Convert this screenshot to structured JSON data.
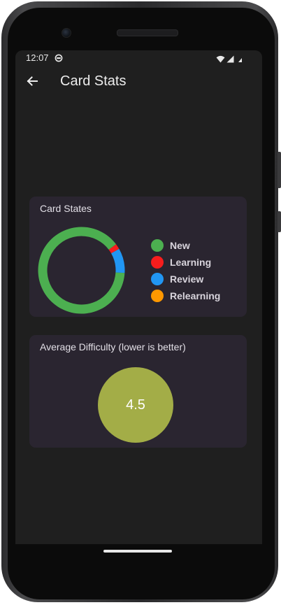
{
  "status_bar": {
    "time": "12:07",
    "icons": [
      "privacy-dot-icon",
      "wifi-icon",
      "cellular-icon",
      "battery-icon"
    ]
  },
  "app_bar": {
    "back_icon": "arrow-left-icon",
    "title": "Card Stats"
  },
  "card_states": {
    "title": "Card States",
    "chart_data": {
      "type": "pie",
      "title": "Card States",
      "donut": true,
      "slices": [
        {
          "name": "New",
          "value": 87,
          "color": "#4caf50"
        },
        {
          "name": "Learning",
          "value": 2,
          "color": "#f81d1d"
        },
        {
          "name": "Review",
          "value": 9,
          "color": "#2196f3"
        },
        {
          "name": "Relearning",
          "value": 0,
          "color": "#ff9800"
        }
      ],
      "legend_position": "right"
    },
    "legend": [
      {
        "label": "New",
        "color": "#4caf50"
      },
      {
        "label": "Learning",
        "color": "#f81d1d"
      },
      {
        "label": "Review",
        "color": "#2196f3"
      },
      {
        "label": "Relearning",
        "color": "#ff9800"
      }
    ]
  },
  "difficulty": {
    "title": "Average Difficulty (lower is better)",
    "value": "4.5",
    "color": "#a3ad47"
  },
  "colors": {
    "screen_bg": "#1f1f1f",
    "card_bg": "#2a2530"
  }
}
